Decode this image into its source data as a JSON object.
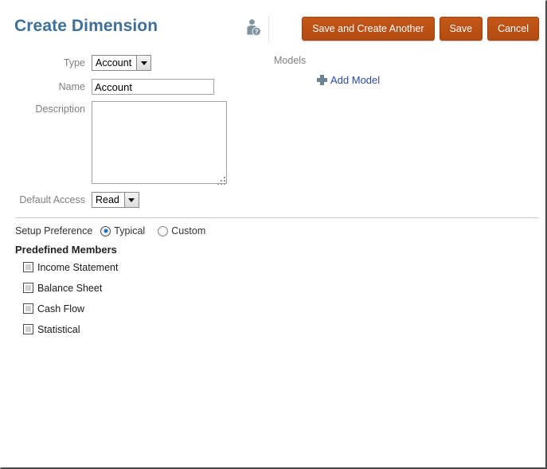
{
  "header": {
    "title": "Create Dimension",
    "help_icon": "person-help-icon",
    "buttons": [
      {
        "id": "save-and-create-another",
        "label": "Save and Create Another"
      },
      {
        "id": "save",
        "label": "Save"
      },
      {
        "id": "cancel",
        "label": "Cancel"
      }
    ],
    "button_color": "#bb5014",
    "title_color": "#3f7097"
  },
  "form": {
    "type": {
      "label": "Type",
      "value": "Account",
      "options": [
        "Account"
      ]
    },
    "name": {
      "label": "Name",
      "value": "Account",
      "placeholder": ""
    },
    "description": {
      "label": "Description",
      "value": "",
      "placeholder": ""
    },
    "default_access": {
      "label": "Default Access",
      "value": "Read",
      "options": [
        "Read"
      ]
    }
  },
  "models": {
    "label": "Models",
    "add_link": "Add Model",
    "plus_icon": "plus-icon",
    "link_color": "#2b4a9b"
  },
  "setup": {
    "label": "Setup Preference",
    "options": [
      {
        "id": "typical",
        "label": "Typical",
        "selected": true
      },
      {
        "id": "custom",
        "label": "Custom",
        "selected": false
      }
    ]
  },
  "predefined_members": {
    "title": "Predefined Members",
    "items": [
      {
        "id": "income-statement",
        "label": "Income Statement",
        "checked": false
      },
      {
        "id": "balance-sheet",
        "label": "Balance Sheet",
        "checked": false
      },
      {
        "id": "cash-flow",
        "label": "Cash Flow",
        "checked": false
      },
      {
        "id": "statistical",
        "label": "Statistical",
        "checked": false
      }
    ]
  }
}
